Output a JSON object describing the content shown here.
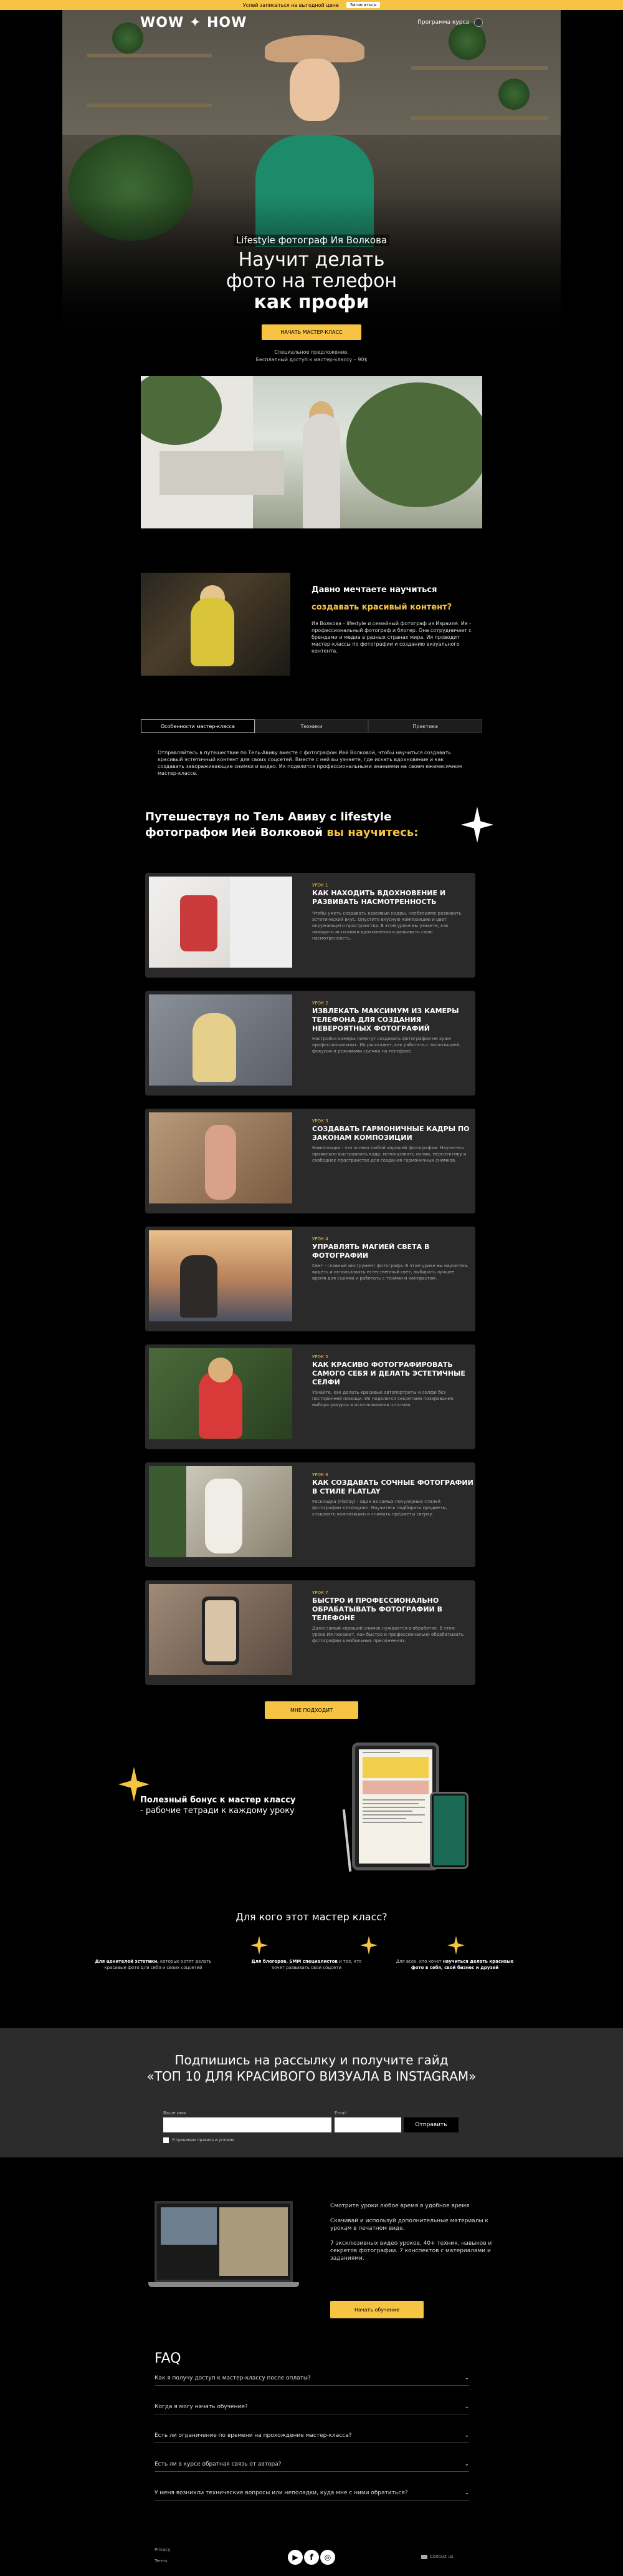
{
  "topbar": {
    "text": "Успей записаться на выгодной цене",
    "button": "Записаться"
  },
  "header": {
    "logo": "WOW ✦ HOW",
    "program": "Программа курса"
  },
  "hero": {
    "subtitle": "Lifestyle фотограф Ия Волкова",
    "title_line1": "Научит делать",
    "title_line2": "фото на телефон",
    "title_bold": "как профи",
    "button": "НАЧАТЬ МАСТЕР-КЛАСС",
    "note_line1": "Специальное предложение.",
    "note_line2": "Бесплатный доступ к мастер-классу – 90$"
  },
  "dream": {
    "title": "Давно мечтаете научиться",
    "title_accent": "создавать красивый контент?",
    "text": "Ия Волкова - lifestyle и семейный фотограф из Израиля. Ия - профессиональный фотограф и блогер. Она сотрудничает с брендами и медиа в разных странах мира. Ия проводит мастер-классы по фотографии и созданию визуального контента."
  },
  "tabs": [
    {
      "label": "Особенности мастер-класса"
    },
    {
      "label": "Техники"
    },
    {
      "label": "Практика"
    }
  ],
  "tab_text": "Отправляйтесь в путешествие по Тель-Авиву вместе с фотографом Ией Волковой, чтобы научиться создавать красивый эстетичный контент для своих соцсетей. Вместе с ней вы узнаете, где искать вдохновение и как создавать завораживающие снимки и видео. Ия поделится профессиональными знаниями на своем ежемесячном мастер-классе.",
  "travel": {
    "title": "Путешествуя по Тель Авиву с lifestyle фотографом Ией Волковой",
    "accent": "вы научитесь:"
  },
  "lessons": [
    {
      "num": "УРОК 1",
      "title": "КАК НАХОДИТЬ ВДОХНОВЕНИЕ И РАЗВИВАТЬ НАСМОТРЕННОСТЬ",
      "desc": "Чтобы уметь создавать красивые кадры, необходимо развивать эстетический вкус. Опустите вкусную композицию и цвет окружающего пространства. В этом уроке вы узнаете, как находить источники вдохновения и развивать свою насмотренность."
    },
    {
      "num": "УРОК 2",
      "title": "ИЗВЛЕКАТЬ МАКСИМУМ ИЗ КАМЕРЫ ТЕЛЕФОНА ДЛЯ СОЗДАНИЯ НЕВЕРОЯТНЫХ ФОТОГРАФИЙ",
      "desc": "Настройки камеры помогут создавать фотографии не хуже профессиональных. Ия расскажет, как работать с экспозицией, фокусом и режимами съемки на телефоне."
    },
    {
      "num": "УРОК 3",
      "title": "СОЗДАВАТЬ ГАРМОНИЧНЫЕ КАДРЫ ПО ЗАКОНАМ КОМПОЗИЦИИ",
      "desc": "Композиция - это основа любой хорошей фотографии. Научитесь правильно выстраивать кадр, использовать линии, перспективу и свободное пространство для создания гармоничных снимков."
    },
    {
      "num": "УРОК 4",
      "title": "УПРАВЛЯТЬ МАГИЕЙ СВЕТА В ФОТОГРАФИИ",
      "desc": "Свет - главный инструмент фотографа. В этом уроке вы научитесь видеть и использовать естественный свет, выбирать лучшее время для съемки и работать с тенями и контрастом."
    },
    {
      "num": "УРОК 5",
      "title": "КАК КРАСИВО ФОТОГРАФИРОВАТЬ САМОГО СЕБЯ И ДЕЛАТЬ ЭСТЕТИЧНЫЕ СЕЛФИ",
      "desc": "Узнайте, как делать красивые автопортреты и селфи без посторонней помощи. Ия поделится секретами позирования, выбора ракурса и использования штатива."
    },
    {
      "num": "УРОК 6",
      "title": "КАК СОЗДАВАТЬ СОЧНЫЕ ФОТОГРАФИИ В СТИЛЕ FLATLAY",
      "desc": "Раскладка (Flatlay) - один из самых популярных стилей фотографии в Instagram. Научитесь подбирать предметы, создавать композицию и снимать предметы сверху."
    },
    {
      "num": "УРОК 7",
      "title": "БЫСТРО И ПРОФЕССИОНАЛЬНО ОБРАБАТЫВАТЬ ФОТОГРАФИИ В ТЕЛЕФОНЕ",
      "desc": "Даже самый хороший снимок нуждается в обработке. В этом уроке Ия покажет, как быстро и профессионально обрабатывать фотографии в мобильных приложениях."
    }
  ],
  "more_button": "МНЕ ПОДХОДИТ",
  "bonus": {
    "bold": "Полезный бонус к мастер классу",
    "text": "- рабочие тетради к каждому уроку"
  },
  "who": {
    "title": "Для кого этот мастер класс?",
    "items": [
      {
        "bold": "Для ценителей эстетики,",
        "text": "которые хотят делать красивые фото для себя и своих соцсетей"
      },
      {
        "bold": "Для блогеров, SMM специалистов",
        "text": "и тех, кто хочет развивать свои соцсети"
      },
      {
        "bold": "научиться делать красивые фото в себя, свой бизнес и друзей",
        "text": "Для всех, кто хочет"
      }
    ]
  },
  "subscribe": {
    "title1": "Подпишись на рассылку и получите гайд",
    "title2": "«ТОП 10 ДЛЯ КРАСИВОГО ВИЗУАЛА В INSTAGRAM»",
    "name_label": "Ваше имя",
    "email_label": "Email",
    "button": "Отправить",
    "consent": "Я принимаю правила и условия"
  },
  "course": {
    "text1": "Смотрите уроки любое время в удобное время",
    "text2": "Скачивай и используй дополнительные материалы к урокам в печатном виде.",
    "text3": "7 эксклюзивных видео уроков, 40+ техник, навыков и секретов фотографии. 7 конспектов с материалами и заданиями.",
    "button": "Начать обучение"
  },
  "faq": {
    "title": "FAQ",
    "items": [
      "Как я получу доступ к мастер-классу после оплаты?",
      "Когда я могу начать обучение?",
      "Есть ли ограничение по времени на прохождение мастер-класса?",
      "Есть ли в курсе обратная связь от автора?",
      "У меня возникли технические вопросы или неполадки, куда мне с ними обратиться?"
    ]
  },
  "footer": {
    "link1": "Privacy",
    "link2": "Terms",
    "contact": "Contact us"
  },
  "colors": {
    "accent": "#f6c343",
    "bg": "#000000",
    "card": "#2a2a2a"
  }
}
